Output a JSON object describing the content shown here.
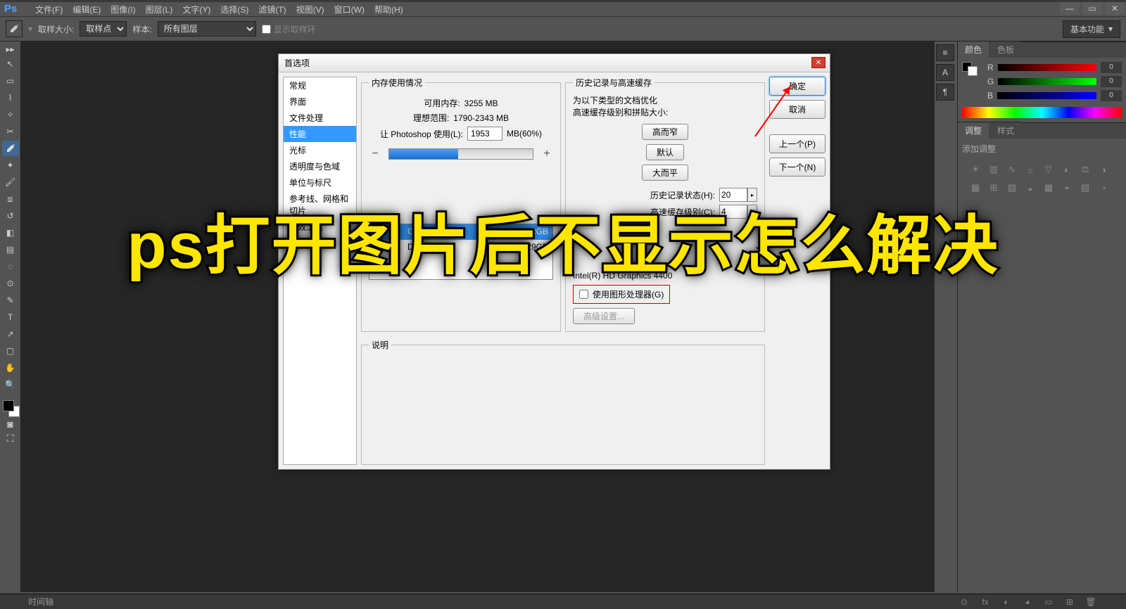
{
  "app": {
    "logo": "Ps"
  },
  "menu": [
    "文件(F)",
    "编辑(E)",
    "图像(I)",
    "图层(L)",
    "文字(Y)",
    "选择(S)",
    "滤镜(T)",
    "视图(V)",
    "窗口(W)",
    "帮助(H)"
  ],
  "options": {
    "sample_size_label": "取样大小:",
    "sample_size_value": "取样点",
    "sample_label": "样本:",
    "sample_value": "所有图层",
    "show_ring": "显示取样环",
    "workspace_btn": "基本功能"
  },
  "panels": {
    "color_tab": "颜色",
    "swatch_tab": "色板",
    "r": "R",
    "g": "G",
    "b": "B",
    "r_val": "0",
    "g_val": "0",
    "b_val": "0",
    "adjust_tab": "调整",
    "style_tab": "样式",
    "add_adjust": "添加调整"
  },
  "status": {
    "timeline": "时间轴"
  },
  "dialog": {
    "title": "首选项",
    "categories": [
      "常规",
      "界面",
      "文件处理",
      "性能",
      "光标",
      "透明度与色域",
      "单位与标尺",
      "参考线、网格和切片",
      "增效工具",
      "文字"
    ],
    "selected_index": 3,
    "buttons": {
      "ok": "确定",
      "cancel": "取消",
      "prev": "上一个(P)",
      "next": "下一个(N)"
    },
    "memory": {
      "legend": "内存使用情况",
      "available_label": "可用内存:",
      "available_value": "3255 MB",
      "ideal_label": "理想范围:",
      "ideal_value": "1790-2343 MB",
      "let_label": "让 Photoshop 使用(L):",
      "let_value": "1953",
      "let_suffix": "MB(60%)"
    },
    "cache": {
      "legend": "历史记录与高速缓存",
      "opt_desc1": "为以下类型的文档优化",
      "opt_desc2": "高速缓存级别和拼贴大小:",
      "btn_tall": "高而窄",
      "btn_default": "默认",
      "btn_flat": "大而平",
      "history_label": "历史记录状态(H):",
      "history_value": "20",
      "cache_label": "高速缓存级别(C):",
      "cache_value": "4"
    },
    "scratch": {
      "col_drive": "C:\\",
      "c_size": "2.42GB",
      "drive2": "D:\\",
      "d_size": "12.29GB",
      "row1_num": "1",
      "row2_num": "2"
    },
    "gpu": {
      "detected": "Intel(R) HD Graphics 4400",
      "use_gpu": "使用图形处理器(G)",
      "advanced": "高级设置..."
    },
    "desc_legend": "说明"
  },
  "headline": "ps打开图片后不显示怎么解决"
}
